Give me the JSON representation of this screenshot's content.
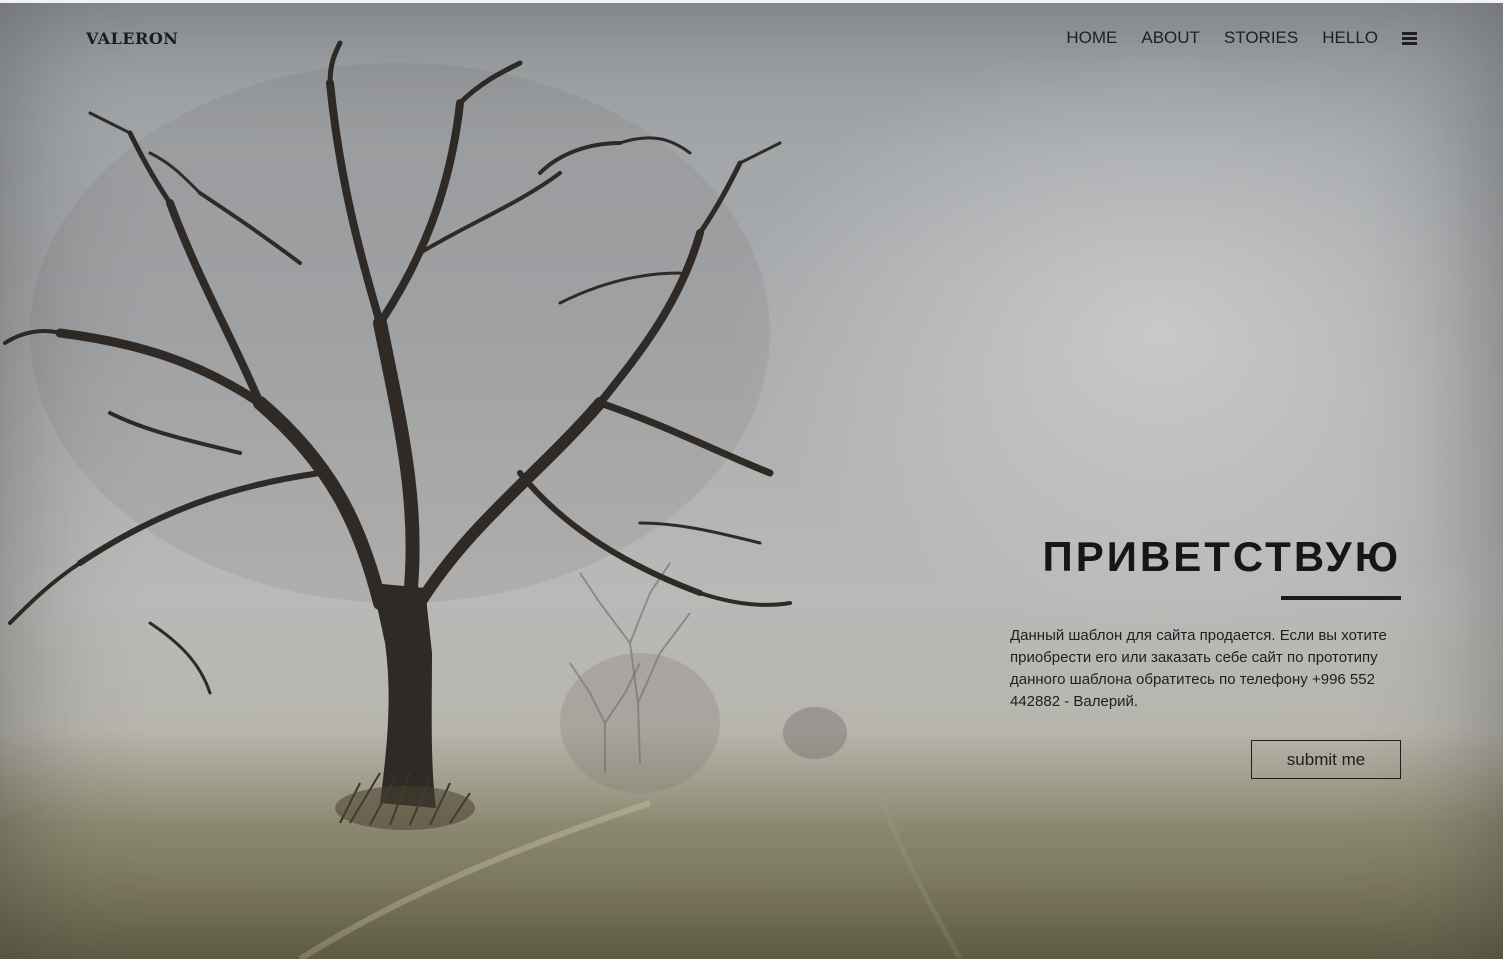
{
  "brand": {
    "logo_text": "VALERON"
  },
  "nav": {
    "items": [
      {
        "label": "HOME"
      },
      {
        "label": "ABOUT"
      },
      {
        "label": "STORIES"
      },
      {
        "label": "HELLO"
      }
    ],
    "menu_icon": "hamburger-menu-icon"
  },
  "hero": {
    "title": "ПРИВЕТСТВУЮ",
    "text": "Данный шаблон для сайта продается. Если вы хотите приобрести его или заказать себе сайт по прототипу данного шаблона обратитесь по телефону +996 552 442882 - Валерий.",
    "button_label": "submit me"
  },
  "colors": {
    "text": "#1f1f1f",
    "sky": "#a9abad",
    "fog": "#b9b9b8",
    "field": "#6f6a4e",
    "tree": "#2e2a25"
  }
}
